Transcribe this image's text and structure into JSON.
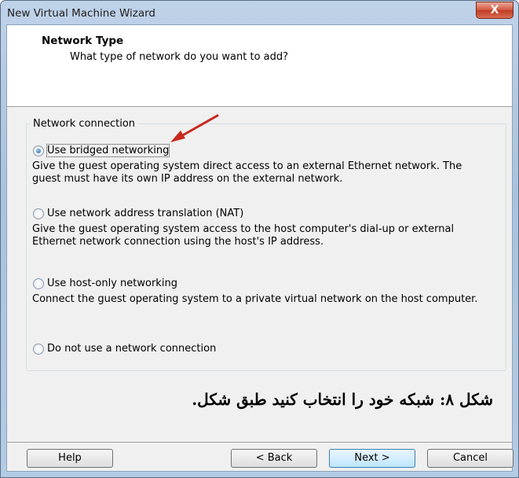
{
  "window": {
    "title": "New Virtual Machine Wizard",
    "close_glyph": "X"
  },
  "header": {
    "title": "Network Type",
    "subtitle": "What type of network do you want to add?"
  },
  "group": {
    "label": "Network connection"
  },
  "options": [
    {
      "label": "Use bridged networking",
      "checked": true,
      "description": "Give the guest operating system direct access to an external Ethernet network. The guest must have its own IP address on the external network."
    },
    {
      "label": "Use network address translation (NAT)",
      "checked": false,
      "description": "Give the guest operating system access to the host computer's dial-up or external Ethernet network connection using the host's IP address."
    },
    {
      "label": "Use host-only networking",
      "checked": false,
      "description": "Connect the guest operating system to a private virtual network on the host computer."
    },
    {
      "label": "Do not use a network connection",
      "checked": false,
      "description": ""
    }
  ],
  "caption": "شکل ۸: شبکه خود را انتخاب کنید طبق شکل.",
  "buttons": {
    "help": "Help",
    "back": "< Back",
    "next": "Next >",
    "cancel": "Cancel"
  },
  "colors": {
    "arrow": "#c8281e",
    "radio_selected": "#1a5da6"
  }
}
